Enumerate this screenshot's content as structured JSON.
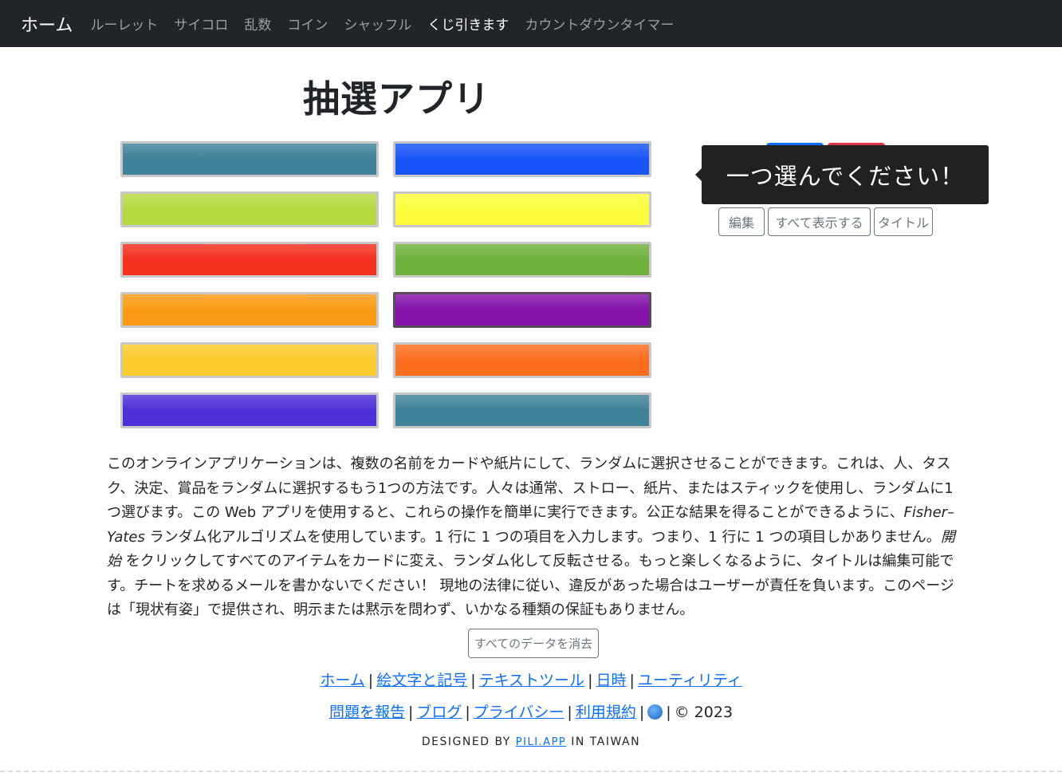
{
  "nav": {
    "brand": "ホーム",
    "items": [
      {
        "label": "ルーレット",
        "active": false
      },
      {
        "label": "サイコロ",
        "active": false
      },
      {
        "label": "乱数",
        "active": false
      },
      {
        "label": "コイン",
        "active": false
      },
      {
        "label": "シャッフル",
        "active": false
      },
      {
        "label": "くじ引きます",
        "active": true
      },
      {
        "label": "カウントダウンタイマー",
        "active": false
      }
    ]
  },
  "page": {
    "title": "抽選アプリ"
  },
  "cards": {
    "left_column": [
      {
        "color": "#3f8199"
      },
      {
        "color": "#b6d940"
      },
      {
        "color": "#f5301f"
      },
      {
        "color": "#fb9b13"
      },
      {
        "color": "#fbcb2b"
      },
      {
        "color": "#4f2fd8"
      }
    ],
    "right_column": [
      {
        "color": "#1854f8"
      },
      {
        "color": "#fcfc3c"
      },
      {
        "color": "#6fb23b"
      },
      {
        "color": "#8513ab"
      },
      {
        "color": "#fb6d1c"
      },
      {
        "color": "#3f8199"
      }
    ]
  },
  "controls": {
    "edit_label": "編集",
    "show_all_label": "すべて表示する",
    "title_label": "タイトル"
  },
  "tooltip": {
    "text": "一つ選んでください！"
  },
  "description": {
    "part1": "このオンラインアプリケーションは、複数の名前をカードや紙片にして、ランダムに選択させることができます。これは、人、タスク、決定、賞品をランダムに選択するもう1つの方法です。人々は通常、ストロー、紙片、またはスティックを使用し、ランダムに1つ選びます。この Web アプリを使用すると、これらの操作を簡単に実行できます。公正な結果を得ることができるように、",
    "algorithm": "Fisher–Yates",
    "part2": " ランダム化アルゴリズムを使用しています。1 行に 1 つの項目を入力します。つまり、1 行に 1 つの項目しかありません。",
    "start": "開始",
    "part3": " をクリックしてすべてのアイテムをカードに変え、ランダム化して反転させる。もっと楽しくなるように、タイトルは編集可能です。チートを求めるメールを書かないでください！ 現地の法律に従い、違反があった場合はユーザーが責任を負います。このページは「現状有姿」で提供され、明示または黙示を問わず、いかなる種類の保証もありません。"
  },
  "clear_button": {
    "label": "すべてのデータを消去"
  },
  "footer": {
    "row1": [
      "ホーム",
      "絵文字と記号",
      "テキストツール",
      "日時",
      "ユーティリティ"
    ],
    "row2": [
      "問題を報告",
      "ブログ",
      "プライバシー",
      "利用規約"
    ],
    "copyright": "© 2023",
    "designed_prefix": "DESIGNED BY",
    "designed_link": "PILI.APP",
    "designed_suffix": "IN TAIWAN"
  }
}
